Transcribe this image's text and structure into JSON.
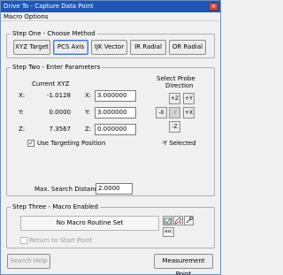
{
  "window": {
    "title": "Drive To - Capture Data Point",
    "close_glyph": "×"
  },
  "menu": {
    "items": [
      "Macro Options"
    ]
  },
  "step_one": {
    "legend": "Step One - Choose Method",
    "methods": [
      "XYZ Target",
      "PCS Axis",
      "IJK Vector",
      "IR Radial",
      "OR Radial"
    ],
    "selected": "PCS Axis"
  },
  "step_two": {
    "legend": "Step Two - Enter Parameters",
    "current_xyz_label": "Current XYZ",
    "current": {
      "x_label": "X:",
      "x": "-1.0128",
      "y_label": "Y:",
      "y": "0.0000",
      "z_label": "Z:",
      "z": "7.3567"
    },
    "target": {
      "x_label": "X:",
      "x": "3.000000",
      "y_label": "Y:",
      "y": "3.000000",
      "z_label": "Z:",
      "z": "0.000000"
    },
    "probe_direction_label_1": "Select Probe",
    "probe_direction_label_2": "Direction",
    "probe_buttons": {
      "pz": "+Z",
      "py": "+Y",
      "mx": "-X",
      "px": "+X",
      "my": "-Y",
      "mz": "-Z"
    },
    "selected_direction": "-Y Selected",
    "use_targeting_label": "Use Targeting Position",
    "use_targeting_checked": true,
    "max_search_label": "Max. Search Distance:",
    "max_search_value": "2.0000"
  },
  "step_three": {
    "legend": "Step Three - Macro Enabled",
    "macro_status": "No Macro Routine Set",
    "esc_label": "esc",
    "return_to_start_label": "Return to Start Point",
    "return_to_start_checked": false
  },
  "footer": {
    "search_help_label": "Search Help",
    "measurement_point_label": "Measurement Point"
  },
  "colors": {
    "titlebar": "#1f57b8",
    "selected_border": "#3a6fd8",
    "close": "#c74b3a"
  }
}
